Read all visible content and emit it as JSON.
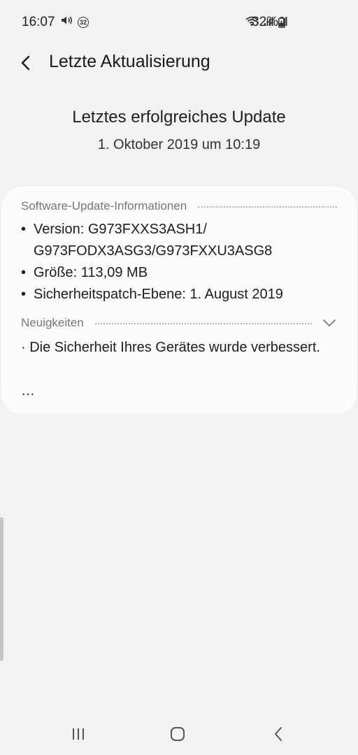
{
  "status_bar": {
    "time": "16:07",
    "notification_count": "32",
    "battery_percent": "32%",
    "icons": [
      "volume-icon",
      "notification-badge-icon",
      "wifi-icon",
      "signal-icon",
      "signal-icon",
      "battery-icon"
    ]
  },
  "header": {
    "title": "Letzte Aktualisierung",
    "back_icon": "back-arrow-icon"
  },
  "hero": {
    "title": "Letztes erfolgreiches Update",
    "date": "1. Oktober 2019 um 10:19"
  },
  "card": {
    "info_section": {
      "label": "Software-Update-Informationen",
      "items": [
        "Version: G973FXXS3ASH1/ G973FODX3ASG3/G973FXXU3ASG8",
        "Größe: 113,09 MB",
        "Sicherheitspatch-Ebene: 1. August 2019"
      ]
    },
    "news_section": {
      "label": "Neuigkeiten",
      "text": "· Die Sicherheit Ihres Gerätes wurde verbessert.",
      "ellipsis": "…"
    }
  },
  "nav_bar": {
    "icons": [
      "recents-icon",
      "home-icon",
      "back-icon"
    ]
  },
  "colors": {
    "background": "#f2f2f2",
    "card": "#fcfcfc",
    "section_label": "#777777"
  }
}
